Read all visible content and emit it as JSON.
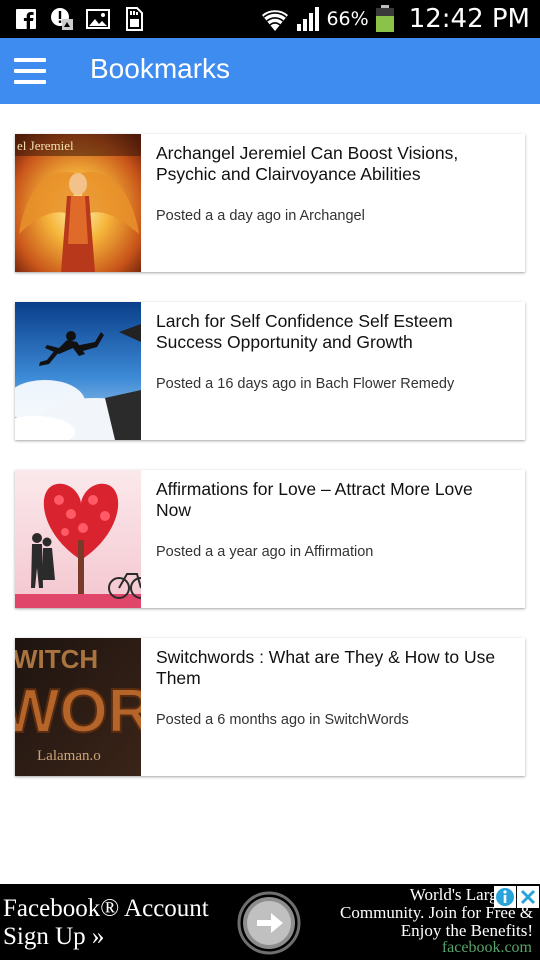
{
  "status_bar": {
    "battery_percent": "66%",
    "time": "12:42 PM",
    "icons": [
      "facebook-notification-icon",
      "alert-notification-icon",
      "gallery-notification-icon",
      "sd-card-notification-icon",
      "wifi-icon",
      "cell-signal-icon",
      "battery-icon"
    ],
    "battery_color": "#8bc34a"
  },
  "app_bar": {
    "title": "Bookmarks",
    "color": "#3e8cf0"
  },
  "bookmarks": [
    {
      "title": "Archangel Jeremiel Can Boost Visions, Psychic and Clairvoyance Abilities",
      "meta": "Posted a a day ago in Archangel",
      "thumb_text": "el Jeremiel"
    },
    {
      "title": "Larch for Self Confidence Self Esteem Success Opportunity and Growth",
      "meta": "Posted a 16 days ago in Bach Flower Remedy"
    },
    {
      "title": "Affirmations for Love – Attract More Love Now",
      "meta": "Posted a a year ago in Affirmation"
    },
    {
      "title": "Switchwords : What are They & How to Use Them",
      "meta": "Posted a 6 months ago in SwitchWords",
      "thumb_text": [
        "WITCH",
        "WORDS",
        "Lalaman.o"
      ]
    }
  ],
  "ad": {
    "headline_line1": "Facebook® Account",
    "headline_line2": "Sign Up »",
    "body_line1": "World's Largest O",
    "body_line2": "Community. Join for Free &",
    "body_line3": "Enjoy the Benefits!",
    "domain": "facebook.com"
  }
}
